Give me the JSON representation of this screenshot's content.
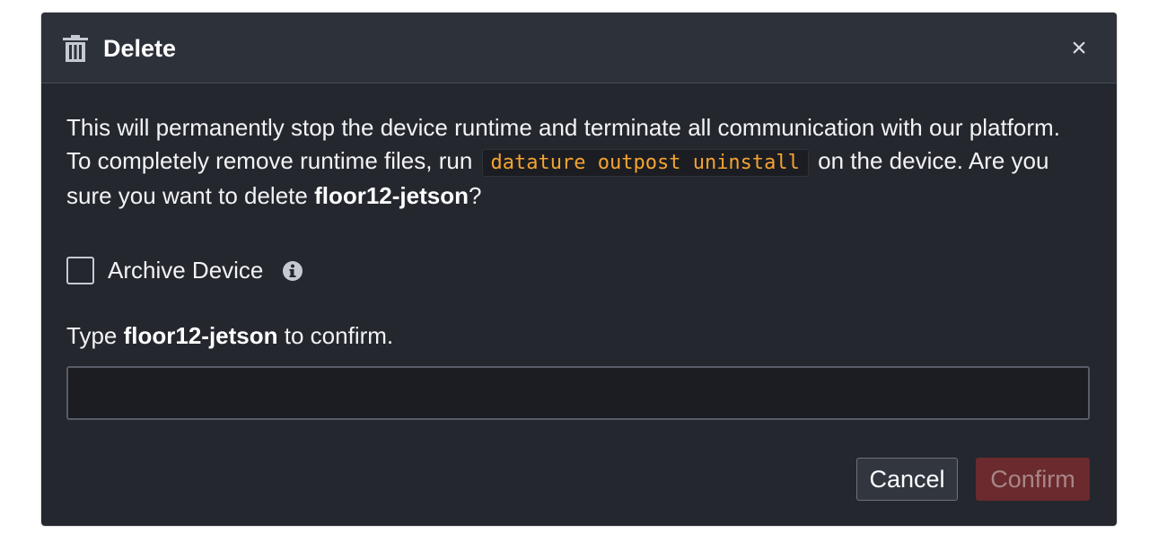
{
  "dialog": {
    "title": "Delete",
    "icon": "trash-icon",
    "close_label": "×",
    "message": {
      "part1": "This will permanently stop the device runtime and terminate all communication with our platform. To completely remove runtime files, run",
      "command": "datature outpost uninstall",
      "part2": "on the device. Are you sure you want to delete",
      "device_name": "floor12-jetson",
      "part3": "?"
    },
    "archive": {
      "label": "Archive Device",
      "checked": false,
      "info_icon": "info-circle-icon"
    },
    "confirm_prompt": {
      "prefix": "Type",
      "device_name": "floor12-jetson",
      "suffix": "to confirm."
    },
    "confirm_input": {
      "value": "",
      "placeholder": ""
    },
    "buttons": {
      "cancel": "Cancel",
      "confirm": "Confirm"
    }
  },
  "colors": {
    "modal_background": "#24272e",
    "header_background": "#2d3139",
    "code_text": "#f5a331",
    "confirm_button_disabled": "#6b2a2d",
    "text": "#f2f3f5"
  }
}
